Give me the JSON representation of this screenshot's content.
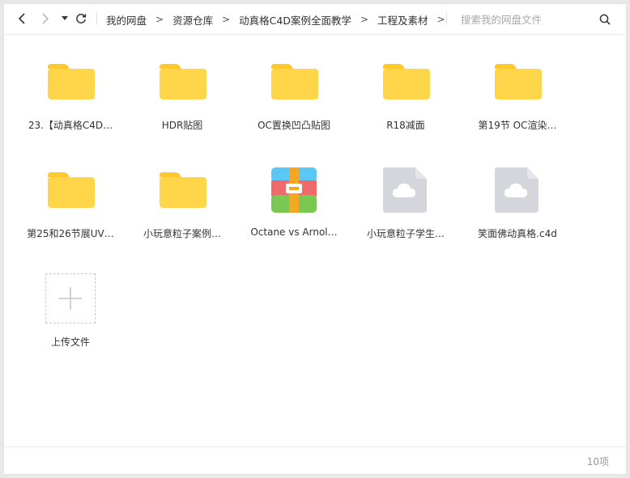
{
  "toolbar": {
    "breadcrumb": [
      "我的网盘",
      "资源仓库",
      "动真格C4D案例全面教学",
      "工程及素材"
    ],
    "crumb_separator": ">",
    "search_placeholder": "搜索我的网盘文件"
  },
  "files": [
    {
      "name": "23.【动真格C4D…",
      "type": "folder"
    },
    {
      "name": "HDR贴图",
      "type": "folder"
    },
    {
      "name": "OC置换凹凸贴图",
      "type": "folder"
    },
    {
      "name": "R18减面",
      "type": "folder"
    },
    {
      "name": "第19节 OC渲染…",
      "type": "folder"
    },
    {
      "name": "第25和26节展UV…",
      "type": "folder"
    },
    {
      "name": "小玩意粒子案例…",
      "type": "folder"
    },
    {
      "name": "Octane vs Arnol…",
      "type": "archive"
    },
    {
      "name": "小玩意粒子学生…",
      "type": "cloud-file"
    },
    {
      "name": "笑面佛动真格.c4d",
      "type": "cloud-file"
    }
  ],
  "upload": {
    "label": "上传文件"
  },
  "status": {
    "count": "10项"
  },
  "colors": {
    "folder": "#ffd54a",
    "folder_tab": "#ffc82c",
    "cloud_file": "#d4d6db",
    "archive_blue": "#5bc7f5",
    "archive_red": "#ef6b6b",
    "archive_green": "#7ac751",
    "archive_orange": "#f5a623"
  }
}
